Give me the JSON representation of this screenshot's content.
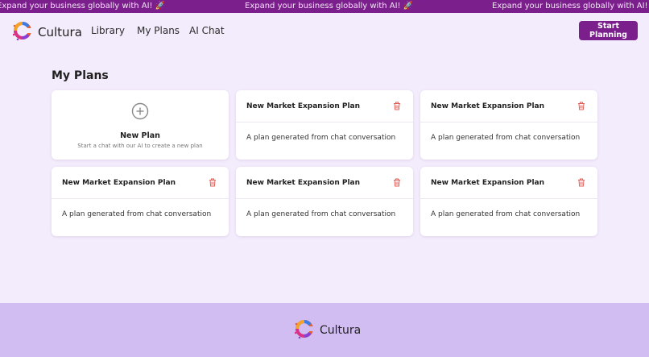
{
  "banner": {
    "text_1": "Expand your business globally with AI! 🚀",
    "text_2": "Expand your business globally with AI! 🚀",
    "text_3": "Expand your business globally with AI! 🚀"
  },
  "nav": {
    "brand": "Cultura",
    "links": [
      "Library",
      "My Plans",
      "AI Chat"
    ],
    "cta_label": "Start Planning"
  },
  "main": {
    "title": "My Plans",
    "new_plan": {
      "title": "New Plan",
      "subtitle": "Start a chat with our AI to create a new plan"
    },
    "plans": [
      {
        "title": "New Market Expansion Plan",
        "description": "A plan generated from chat conversation"
      },
      {
        "title": "New Market Expansion Plan",
        "description": "A plan generated from chat conversation"
      },
      {
        "title": "New Market Expansion Plan",
        "description": "A plan generated from chat conversation"
      },
      {
        "title": "New Market Expansion Plan",
        "description": "A plan generated from chat conversation"
      },
      {
        "title": "New Market Expansion Plan",
        "description": "A plan generated from chat conversation"
      }
    ]
  },
  "footer": {
    "brand": "Cultura"
  },
  "icons": {
    "logo": "cultura-logo-icon",
    "new": "plus-circle-icon",
    "delete": "trash-icon"
  },
  "colors": {
    "accent": "#7b1f8c",
    "background": "#f3ecfc",
    "footer": "#d1bdf2",
    "delete": "#e0605a"
  }
}
